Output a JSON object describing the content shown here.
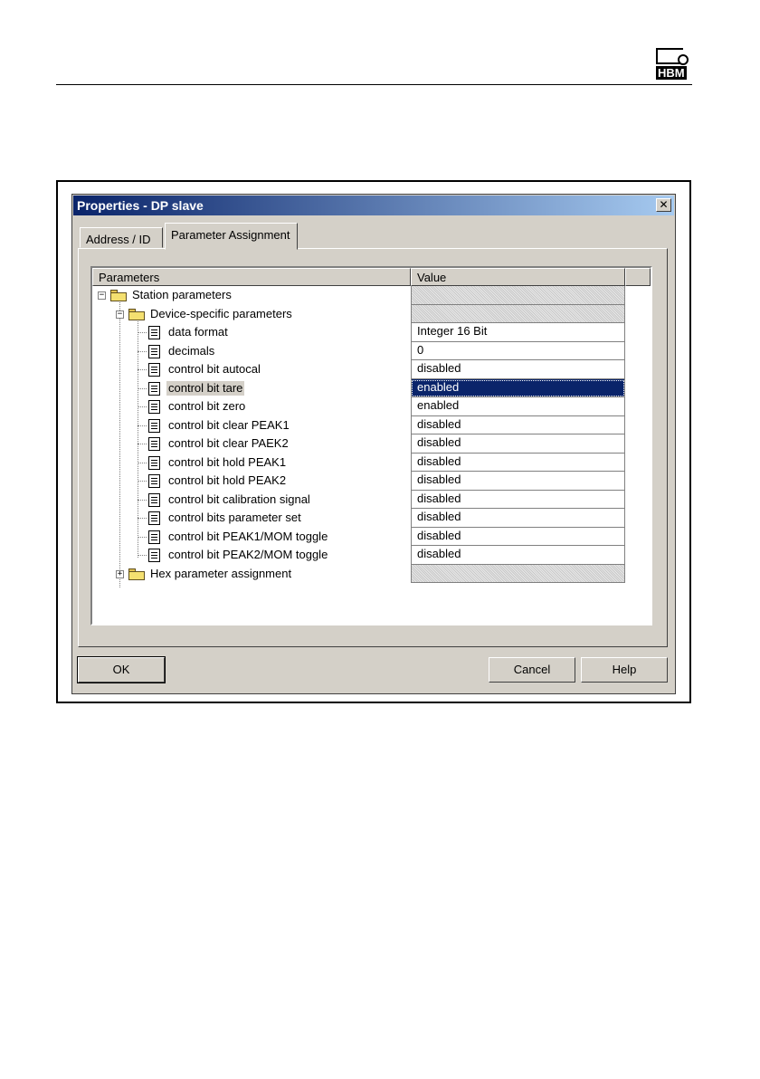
{
  "page": {
    "logo_text": "HBM"
  },
  "dialog": {
    "title": "Properties - DP slave",
    "close_label": "✕",
    "tabs": [
      "Address / ID",
      "Parameter Assignment"
    ],
    "columns": {
      "parameters": "Parameters",
      "value": "Value"
    },
    "rows": [
      {
        "label": "Station parameters",
        "value": ""
      },
      {
        "label": "Device-specific parameters",
        "value": ""
      },
      {
        "label": "data format",
        "value": "Integer 16 Bit"
      },
      {
        "label": "decimals",
        "value": "0"
      },
      {
        "label": "control bit autocal",
        "value": "disabled"
      },
      {
        "label": "control bit tare",
        "value": "enabled"
      },
      {
        "label": "control bit zero",
        "value": "enabled"
      },
      {
        "label": "control bit clear PEAK1",
        "value": "disabled"
      },
      {
        "label": "control bit clear PAEK2",
        "value": "disabled"
      },
      {
        "label": "control bit hold PEAK1",
        "value": "disabled"
      },
      {
        "label": "control bit hold PEAK2",
        "value": "disabled"
      },
      {
        "label": "control bit calibration signal",
        "value": "disabled"
      },
      {
        "label": "control bits parameter set",
        "value": "disabled"
      },
      {
        "label": "control bit PEAK1/MOM toggle",
        "value": "disabled"
      },
      {
        "label": "control bit PEAK2/MOM toggle",
        "value": "disabled"
      },
      {
        "label": "Hex parameter assignment",
        "value": ""
      }
    ],
    "buttons": {
      "ok": "OK",
      "cancel": "Cancel",
      "help": "Help"
    }
  }
}
